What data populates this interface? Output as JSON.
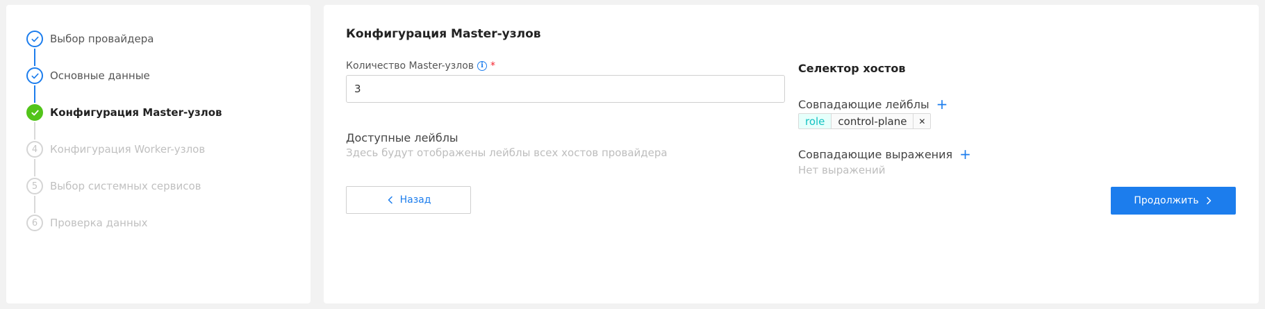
{
  "steps": [
    {
      "number": "1",
      "label": "Выбор провайдера",
      "status": "done"
    },
    {
      "number": "2",
      "label": "Основные данные",
      "status": "done"
    },
    {
      "number": "3",
      "label": "Конфигурация Master-узлов",
      "status": "active"
    },
    {
      "number": "4",
      "label": "Конфигурация Worker-узлов",
      "status": "pending"
    },
    {
      "number": "5",
      "label": "Выбор системных сервисов",
      "status": "pending"
    },
    {
      "number": "6",
      "label": "Проверка данных",
      "status": "pending"
    }
  ],
  "panel": {
    "title": "Конфигурация Master-узлов",
    "count_label": "Количество Master-узлов",
    "required_mark": "*",
    "count_value": "3",
    "available_labels_title": "Доступные лейблы",
    "available_labels_hint": "Здесь будут отображены лейблы всех хостов провайдера",
    "back_label": "Назад"
  },
  "selector": {
    "title": "Селектор хостов",
    "match_labels_title": "Совпадающие лейблы",
    "tag": {
      "key": "role",
      "value": "control-plane"
    },
    "match_expressions_title": "Совпадающие выражения",
    "no_expressions": "Нет выражений",
    "next_label": "Продолжить"
  },
  "colors": {
    "primary": "#1c7ded",
    "success": "#52c41a",
    "required": "#f5222d",
    "tag_key": "#13c2c2"
  },
  "icons": {
    "done": "check-icon",
    "active": "check-icon",
    "info": "info-icon",
    "add": "plus-icon",
    "close": "close-icon",
    "back": "chevron-left-icon",
    "next": "chevron-right-icon"
  }
}
